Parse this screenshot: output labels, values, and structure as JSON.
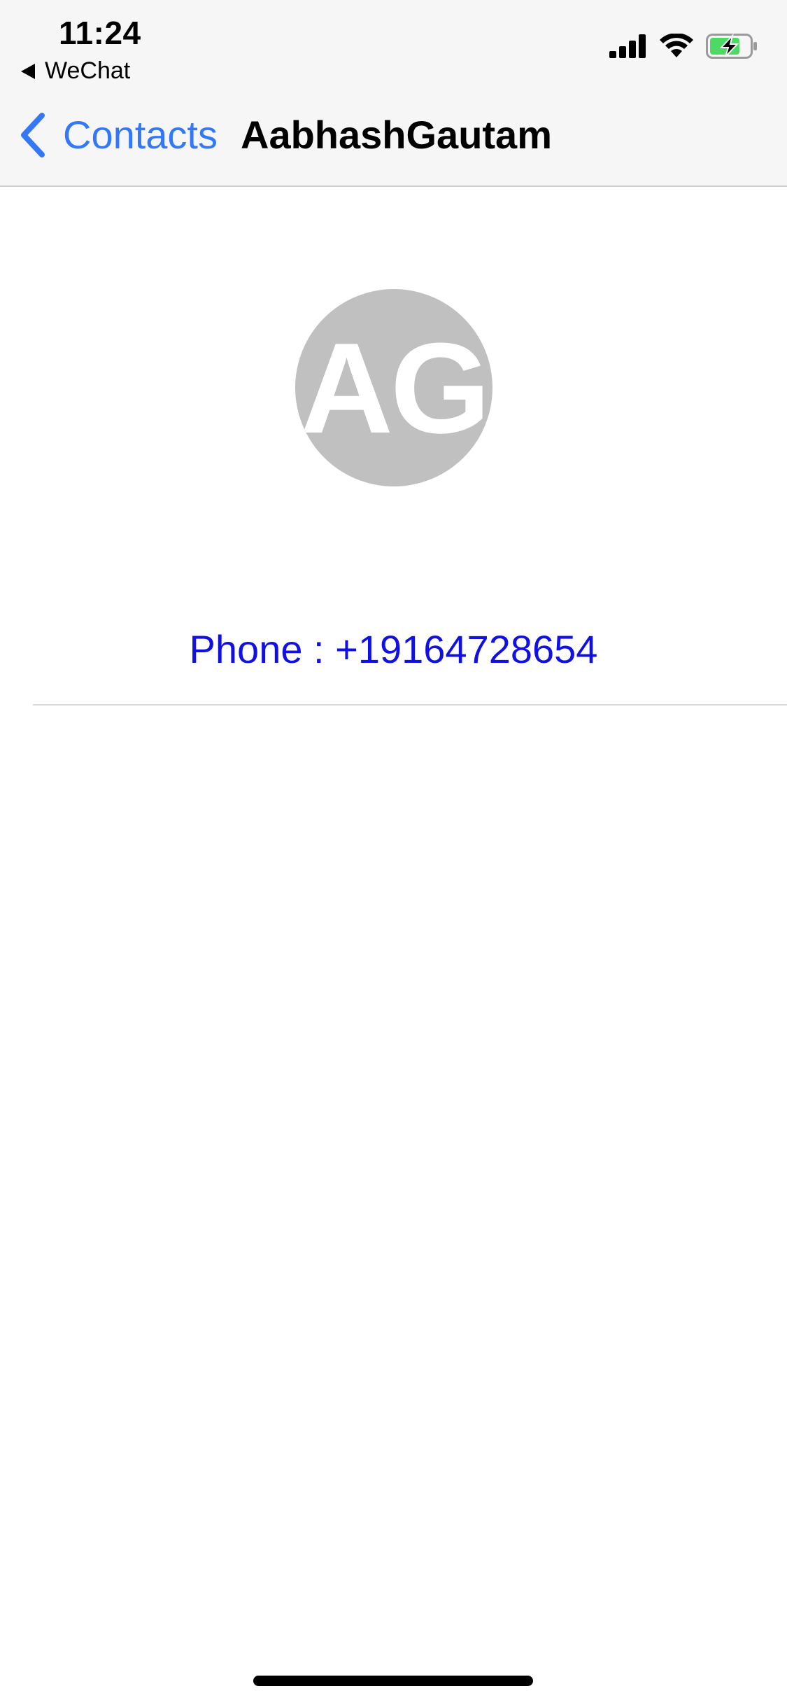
{
  "status_bar": {
    "time": "11:24",
    "back_app": "WeChat",
    "icons": [
      "cellular-signal-icon",
      "wifi-icon",
      "battery-charging-icon"
    ],
    "battery_fill_color": "#4cd964"
  },
  "nav": {
    "back_label": "Contacts",
    "title": "AabhashGautam",
    "accent_color": "#3478f6"
  },
  "contact": {
    "initials": "AG",
    "avatar_color": "#c0c0c0",
    "phone_text": "Phone : +19164728654",
    "phone_color": "#1010e0"
  }
}
